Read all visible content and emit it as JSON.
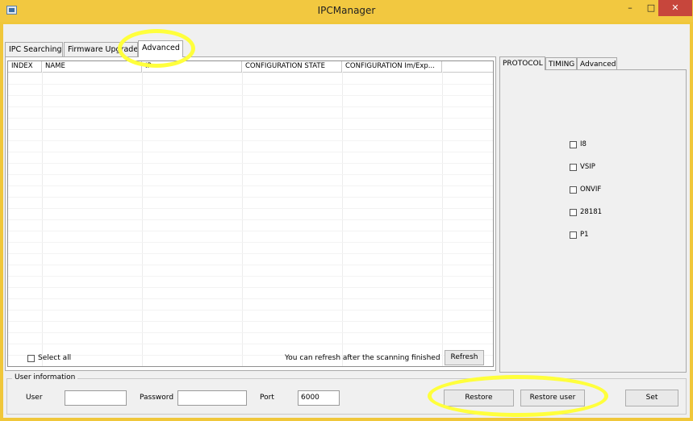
{
  "window": {
    "title": "IPCManager",
    "min": "–",
    "max": "□",
    "close": "✕"
  },
  "main_tabs": [
    "IPC Searching",
    "Firmware Upgrade",
    "Advanced"
  ],
  "table": {
    "columns": [
      "INDEX",
      "NAME",
      "IP",
      "CONFIGURATION STATE",
      "CONFIGURATION Im/Exp..."
    ]
  },
  "side_tabs": [
    "PROTOCOL",
    "TIMING",
    "Advanced"
  ],
  "protocols": [
    "I8",
    "VSIP",
    "ONVIF",
    "28181",
    "P1"
  ],
  "select_all": "Select all",
  "refresh_hint": "You can refresh after the scanning finished",
  "refresh": "Refresh",
  "user_info": {
    "title": "User information",
    "user_label": "User",
    "password_label": "Password",
    "port_label": "Port",
    "user_value": "",
    "password_value": "",
    "port_value": "6000"
  },
  "buttons": {
    "restore": "Restore",
    "restore_user": "Restore user",
    "set": "Set"
  },
  "colors": {
    "highlight": "#ffff3c",
    "frame": "#f0c73a",
    "close": "#c7463c"
  }
}
